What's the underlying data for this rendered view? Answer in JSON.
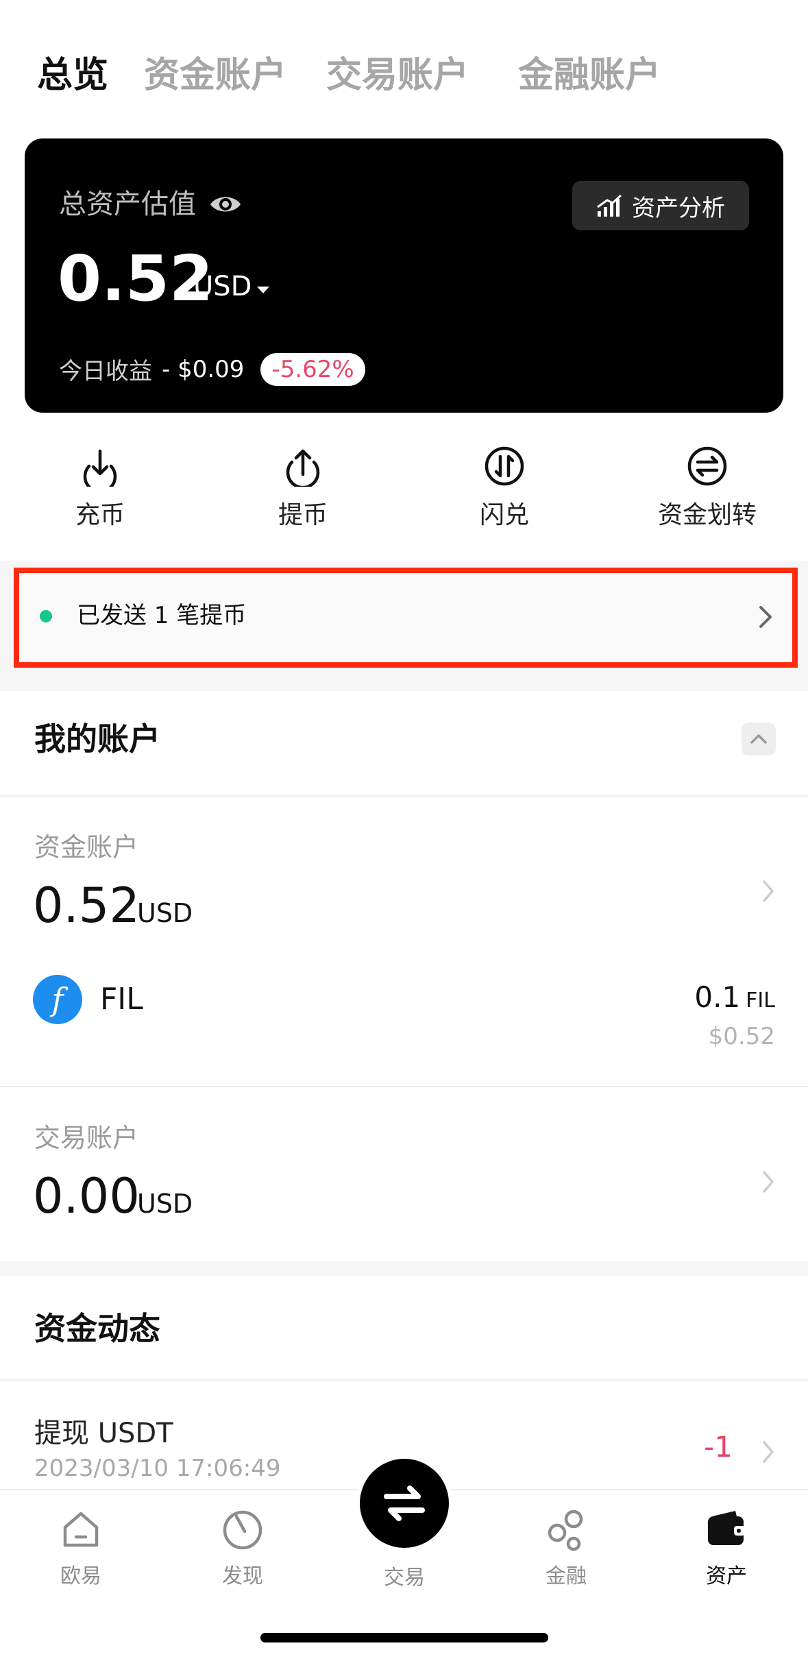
{
  "tabs": [
    {
      "label": "总览",
      "active": true
    },
    {
      "label": "资金账户",
      "active": false
    },
    {
      "label": "交易账户",
      "active": false
    },
    {
      "label": "金融账户",
      "active": false
    }
  ],
  "asset_card": {
    "label": "总资产估值",
    "eye_icon": "eye-icon",
    "analysis_button": "资产分析",
    "total_amount": "0.52",
    "currency": "USD",
    "today_label": "今日收益",
    "today_value": "- $0.09",
    "today_pct": "-5.62%"
  },
  "actions": [
    {
      "label": "充币",
      "icon": "deposit-icon"
    },
    {
      "label": "提币",
      "icon": "withdraw-icon"
    },
    {
      "label": "闪兑",
      "icon": "convert-icon"
    },
    {
      "label": "资金划转",
      "icon": "transfer-icon"
    }
  ],
  "notice": {
    "text": "已发送 1 笔提币",
    "highlight_color": "#ff2a10",
    "dot_color": "#17c78d"
  },
  "my_accounts": {
    "title": "我的账户",
    "funding": {
      "label": "资金账户",
      "amount": "0.52",
      "unit": "USD",
      "assets": [
        {
          "symbol": "FIL",
          "qty": "0.1",
          "qty_unit": "FIL",
          "usd": "$0.52"
        }
      ]
    },
    "trading": {
      "label": "交易账户",
      "amount": "0.00",
      "unit": "USD"
    }
  },
  "fund_activity": {
    "title": "资金动态",
    "items": [
      {
        "title": "提现 USDT",
        "time": "2023/03/10 17:06:49",
        "amount": "-1"
      }
    ]
  },
  "bottom_nav": [
    {
      "label": "欧易",
      "icon": "home-icon",
      "active": false
    },
    {
      "label": "发现",
      "icon": "discover-icon",
      "active": false
    },
    {
      "label": "交易",
      "icon": "trade-swap-icon",
      "active": false
    },
    {
      "label": "金融",
      "icon": "finance-icon",
      "active": false
    },
    {
      "label": "资产",
      "icon": "wallet-icon",
      "active": true
    }
  ],
  "colors": {
    "negative": "#e6476a",
    "accent_blue": "#1d8ef0"
  }
}
